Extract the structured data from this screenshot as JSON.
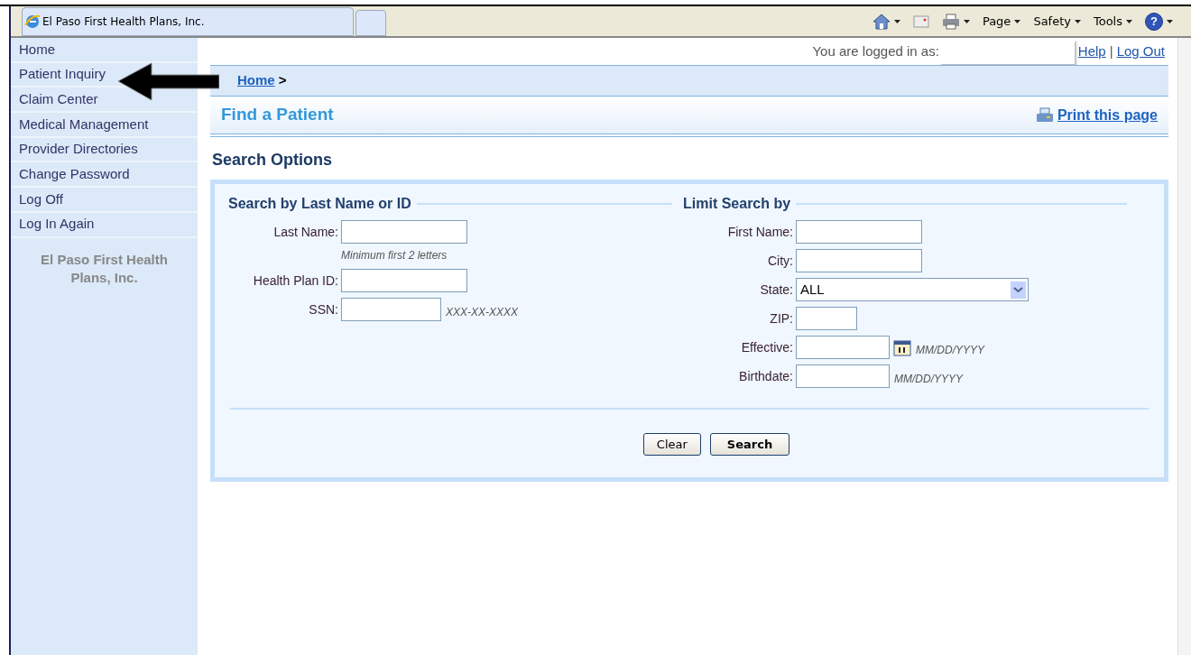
{
  "browser": {
    "tab_title": "El Paso First Health Plans, Inc.",
    "command_bar": [
      {
        "kind": "home",
        "dropdown": true
      },
      {
        "kind": "feeds",
        "dropdown": false
      },
      {
        "kind": "print",
        "dropdown": true
      },
      {
        "kind": "menu",
        "label": "Page",
        "dropdown": true
      },
      {
        "kind": "menu",
        "label": "Safety",
        "dropdown": true
      },
      {
        "kind": "menu",
        "label": "Tools",
        "dropdown": true
      },
      {
        "kind": "help",
        "label": "?",
        "dropdown": true
      }
    ]
  },
  "sidebar": {
    "items": [
      "Home",
      "Patient Inquiry",
      "Claim Center",
      "Medical Management",
      "Provider Directories",
      "Change Password",
      "Log Off",
      "Log In Again"
    ],
    "footer": "El Paso First Health Plans, Inc."
  },
  "header": {
    "logged_in_label": "You are logged in as:",
    "links": [
      "Help",
      "Log Out"
    ],
    "link_separator": "|"
  },
  "breadcrumb": {
    "link": "Home",
    "separator": ">"
  },
  "page_title": "Find a Patient",
  "print_link": "Print this page",
  "section_title": "Search Options",
  "groups": [
    {
      "legend": "Search by Last Name or ID",
      "fields": [
        {
          "label": "Last Name:",
          "kind": "text",
          "note": "Minimum first 2 letters"
        },
        {
          "label": "Health Plan ID:",
          "kind": "text"
        },
        {
          "label": "SSN:",
          "kind": "short",
          "hint": "XXX-XX-XXXX"
        }
      ]
    },
    {
      "legend": "Limit Search by",
      "fields": [
        {
          "label": "First Name:",
          "kind": "text"
        },
        {
          "label": "City:",
          "kind": "text"
        },
        {
          "label": "State:",
          "kind": "select",
          "value": "ALL"
        },
        {
          "label": "ZIP:",
          "kind": "tiny"
        },
        {
          "label": "Effective:",
          "kind": "date",
          "calendar": true,
          "hint": "MM/DD/YYYY"
        },
        {
          "label": "Birthdate:",
          "kind": "date",
          "calendar": false,
          "hint": "MM/DD/YYYY"
        }
      ]
    }
  ],
  "buttons": [
    {
      "label": "Clear",
      "primary": false
    },
    {
      "label": "Search",
      "primary": true
    }
  ]
}
